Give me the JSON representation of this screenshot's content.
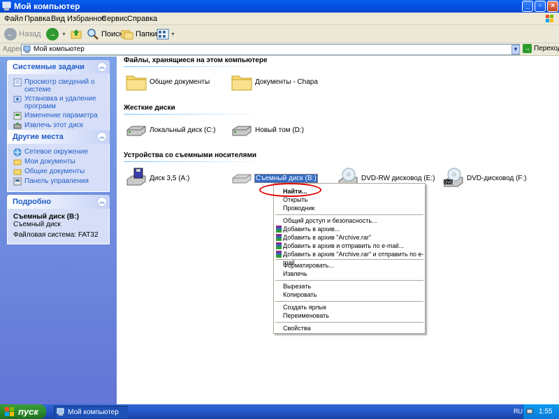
{
  "window": {
    "title": "Мой компьютер"
  },
  "menu": [
    "Файл",
    "Правка",
    "Вид",
    "Избранное",
    "Сервис",
    "Справка"
  ],
  "toolbar": {
    "back": "Назад",
    "search": "Поиск",
    "folders": "Папки"
  },
  "address": {
    "label": "Адрес:",
    "value": "Мой компьютер",
    "go": "Переход"
  },
  "left": {
    "system_tasks": {
      "title": "Системные задачи",
      "items": [
        "Просмотр сведений о системе",
        "Установка и удаление программ",
        "Изменение параметра",
        "Извлечь этот диск"
      ]
    },
    "other_places": {
      "title": "Другие места",
      "items": [
        "Сетевое окружение",
        "Мои документы",
        "Общие документы",
        "Панель управления"
      ]
    },
    "details": {
      "title": "Подробно",
      "name": "Съемный диск (B:)",
      "type": "Съемный диск",
      "fs": "Файловая система: FAT32"
    }
  },
  "main": {
    "sections": {
      "files": "Файлы, хранящиеся на этом компьютере",
      "hdd": "Жесткие диски",
      "removable": "Устройства со съемными носителями"
    },
    "files": [
      "Общие документы",
      "Документы - Chapa"
    ],
    "hdd": [
      "Локальный диск (C:)",
      "Новый том (D:)"
    ],
    "removable": [
      "Диск 3,5 (A:)",
      "Съемный диск (B:)",
      "DVD-RW дисковод (E:)",
      "DVD-дисковод (F:)"
    ]
  },
  "context_menu": {
    "find": "Найти...",
    "open": "Открыть",
    "explorer": "Проводник",
    "sharing": "Общий доступ и безопасность...",
    "add_archive": "Добавить в архив...",
    "add_rar": "Добавить в архив \"Archive.rar\"",
    "add_email": "Добавить в архив и отправить по e-mail...",
    "add_rar_email": "Добавить в архив \"Archive.rar\" и отправить по e-mail",
    "format": "Форматировать...",
    "eject": "Извлечь",
    "cut": "Вырезать",
    "copy": "Копировать",
    "shortcut": "Создать ярлык",
    "rename": "Переименовать",
    "properties": "Свойства"
  },
  "taskbar": {
    "start": "пуск",
    "task": "Мой компьютер",
    "lang": "RU",
    "clock": "1:55"
  },
  "dvd_badge": "DVD",
  "colors": {
    "accent": "#215dc6",
    "selection": "#316ac5",
    "highlight": "#e00000"
  }
}
